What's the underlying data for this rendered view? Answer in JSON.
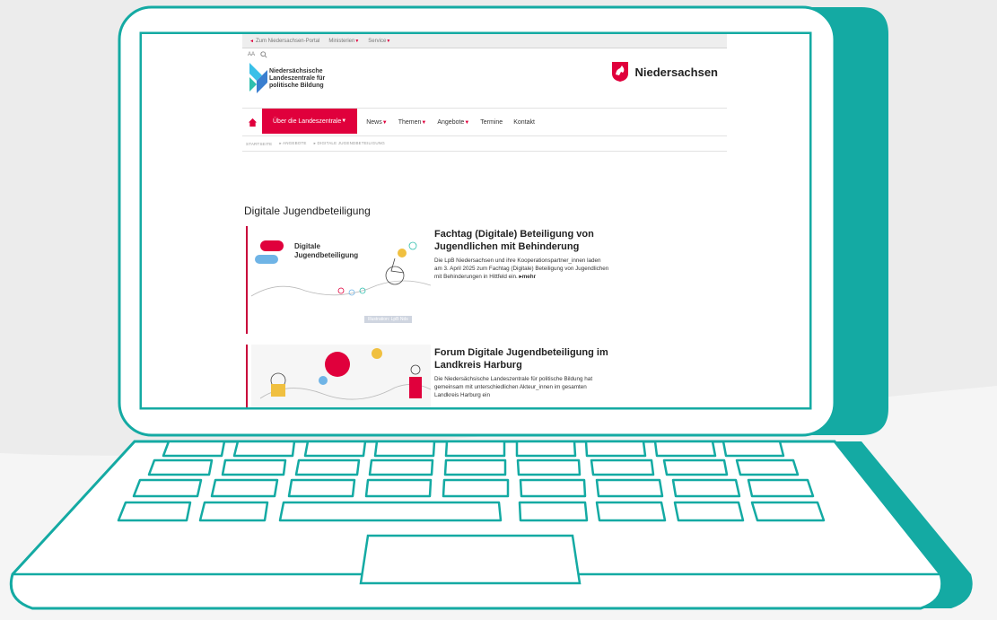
{
  "site": {
    "topbar": {
      "portal_link": "Zum Niedersachsen-Portal",
      "ministries": "Ministerien",
      "service": "Service"
    },
    "tools": {
      "font_size": "AA",
      "search_icon": "search-icon"
    },
    "logo": {
      "org_name_line1": "Niedersächsische",
      "org_name_line2": "Landeszentrale für",
      "org_name_line3": "politische Bildung"
    },
    "state_logo": {
      "name": "Niedersachsen",
      "icon": "horse-crest-icon"
    },
    "nav": {
      "home_icon": "home-icon",
      "items": [
        "Über die Landeszentrale",
        "News",
        "Themen",
        "Angebote",
        "Termine",
        "Kontakt"
      ]
    },
    "breadcrumb": [
      "STARTSEITE",
      "ANGEBOTE",
      "DIGITALE JUGENDBETEILIGUNG"
    ],
    "page_title": "Digitale Jugendbeteiligung",
    "articles": [
      {
        "title": "Fachtag (Digitale) Beteiligung von Jugendlichen mit Behinderung",
        "teaser": "Die LpB Niedersachsen und ihre Kooperationspartner_innen laden am 3. April 2025 zum Fachtag (Digitale) Beteiligung von Jugendlichen mit Behinderungen in Hittfeld ein.",
        "more": "mehr",
        "image_text_line1": "Digitale",
        "image_text_line2": "Jugendbeteiligung",
        "image_caption": "Illustration: LpB Nds"
      },
      {
        "title": "Forum Digitale Jugendbeteiligung im Landkreis Harburg",
        "teaser": "Die Niedersächsische Landeszentrale für politische Bildung hat gemeinsam mit unterschiedlichen Akteur_innen im gesamten Landkreis Harburg ein"
      }
    ]
  },
  "colors": {
    "accent": "#e0003c",
    "laptop_teal": "#14aaa3",
    "background": "#ececec",
    "text": "#222222"
  }
}
